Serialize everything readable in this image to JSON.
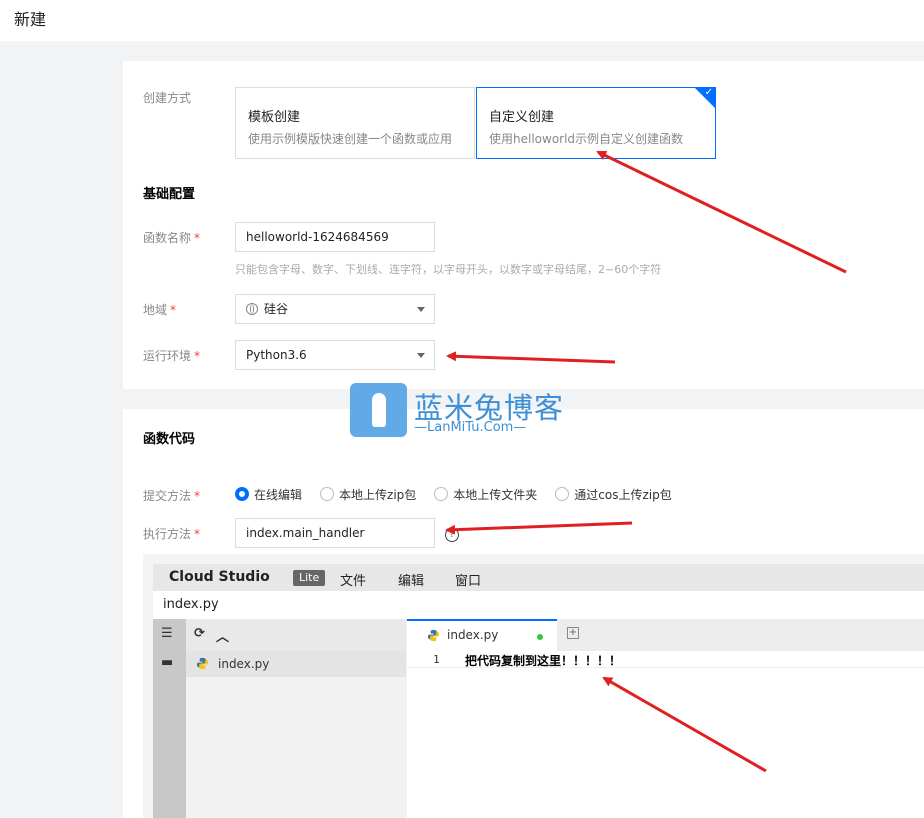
{
  "page": {
    "title": "新建"
  },
  "creation": {
    "label": "创建方式",
    "options": [
      {
        "title": "模板创建",
        "desc": "使用示例模版快速创建一个函数或应用",
        "selected": false
      },
      {
        "title": "自定义创建",
        "desc": "使用helloworld示例自定义创建函数",
        "selected": true
      }
    ]
  },
  "basic": {
    "section_title": "基础配置",
    "function_name": {
      "label": "函数名称",
      "required_mark": "*",
      "value": "helloworld-1624684569",
      "hint": "只能包含字母、数字、下划线、连字符，以字母开头，以数字或字母结尾，2~60个字符"
    },
    "region": {
      "label": "地域",
      "required_mark": "*",
      "value": "硅谷"
    },
    "runtime": {
      "label": "运行环境",
      "required_mark": "*",
      "value": "Python3.6"
    }
  },
  "code": {
    "section_title": "函数代码",
    "submit": {
      "label": "提交方法",
      "required_mark": "*",
      "options": [
        {
          "label": "在线编辑",
          "checked": true
        },
        {
          "label": "本地上传zip包",
          "checked": false
        },
        {
          "label": "本地上传文件夹",
          "checked": false
        },
        {
          "label": "通过cos上传zip包",
          "checked": false
        }
      ]
    },
    "handler": {
      "label": "执行方法",
      "required_mark": "*",
      "value": "index.main_handler"
    }
  },
  "ide": {
    "brand": "Cloud Studio",
    "badge": "Lite",
    "menu": [
      "文件",
      "编辑",
      "窗口"
    ],
    "open_file": "index.py",
    "explorer_file": "index.py",
    "tab_label": "index.py",
    "code_lines": [
      {
        "no": "1",
        "text": "把代码复制到这里！！！！！"
      }
    ]
  },
  "watermark": {
    "title": "蓝米兔博客",
    "subtitle": "—LanMiTu.Com—"
  },
  "colors": {
    "accent": "#006eff",
    "required": "#e54545",
    "annotation_arrow": "#e02020",
    "watermark": "#3d8fd8"
  },
  "icons": [
    "check-icon",
    "globe-icon",
    "chevron-down-icon",
    "help-icon",
    "file-tree-icon",
    "folder-icon",
    "refresh-icon",
    "collapse-icon",
    "python-file-icon",
    "unsaved-dot-icon",
    "add-tab-icon"
  ]
}
